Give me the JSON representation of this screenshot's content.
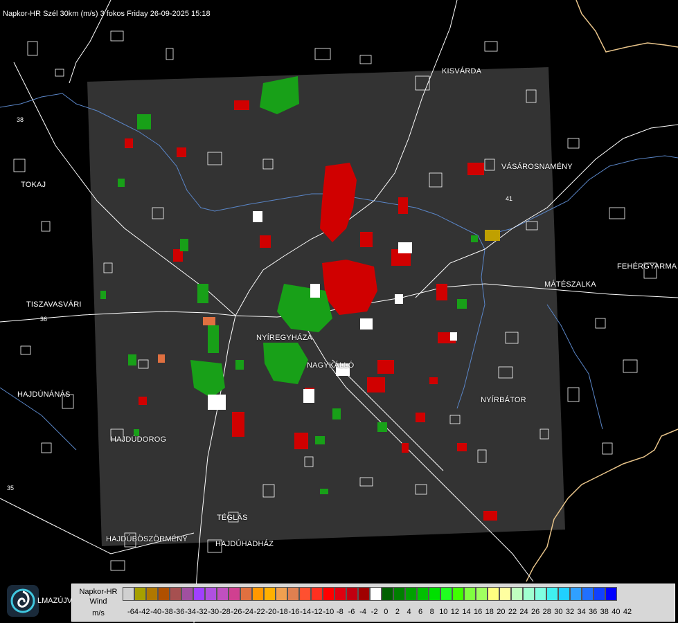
{
  "header": {
    "title": "Napkor-HR Szél 30km (m/s) 3 fokos Friday 26-09-2025 15:18"
  },
  "map": {
    "cities": [
      {
        "id": "kisvarda",
        "label": "KISVÁRDA"
      },
      {
        "id": "tokaj",
        "label": "TOKAJ"
      },
      {
        "id": "vasarosnameny",
        "label": "VÁSÁROSNAMÉNY"
      },
      {
        "id": "fehergyarmat",
        "label": "FEHÉRGYARMA"
      },
      {
        "id": "mateszalka",
        "label": "MÁTÉSZALKA"
      },
      {
        "id": "tiszavasvari",
        "label": "TISZAVASVÁRI"
      },
      {
        "id": "nyiregyhaza",
        "label": "NYÍREGYHÁZA"
      },
      {
        "id": "nagykallo",
        "label": "NAGYKÁLLÓ"
      },
      {
        "id": "hajdunanas",
        "label": "HAJDÚNÁNÁS"
      },
      {
        "id": "nyirbator",
        "label": "NYÍRBÁTOR"
      },
      {
        "id": "hajdudorog",
        "label": "HAJDÚDOROG"
      },
      {
        "id": "teglas",
        "label": "TÉGLÁS"
      },
      {
        "id": "hajduboszormeny",
        "label": "HAJDÚBÖSZÖRMÉNY"
      },
      {
        "id": "hajduhadhaz",
        "label": "HAJDÚHADHÁZ"
      }
    ],
    "road_numbers": [
      "38",
      "36",
      "41",
      "35"
    ],
    "colors": {
      "background": "#000000",
      "radar_area": "#333333",
      "roads": "#ffffff",
      "rivers": "#5a86c8",
      "border": "#e8c48a"
    }
  },
  "footer": {
    "logo_text": "LMAZÚJVÁR",
    "logo_icon": "swirl-logo-icon",
    "legend": {
      "title_line1": "Napkor-HR",
      "title_line2": "Wind",
      "units": "m/s",
      "swatches": [
        "#d0d0d0",
        "#a6a000",
        "#b07800",
        "#b05000",
        "#a65050",
        "#a050a0",
        "#a040ff",
        "#b050e0",
        "#c050c0",
        "#d04090",
        "#e07040",
        "#ff9800",
        "#ffb000",
        "#f0a050",
        "#e08050",
        "#ff5030",
        "#ff3020",
        "#ff0000",
        "#e00010",
        "#c00010",
        "#a00000",
        "#ffffff",
        "#006000",
        "#008000",
        "#00a000",
        "#00c000",
        "#00e000",
        "#20ff20",
        "#40ff00",
        "#80ff40",
        "#a0ff60",
        "#ffff80",
        "#ffffa0",
        "#c0ffc0",
        "#a0ffd0",
        "#80ffe0",
        "#40f0f0",
        "#20d0ff",
        "#30a0ff",
        "#2070ff",
        "#1040ff",
        "#0000ff"
      ],
      "ticks": [
        "-64",
        "-42",
        "-40",
        "-38",
        "-36",
        "-34",
        "-32",
        "-30",
        "-28",
        "-26",
        "-24",
        "-22",
        "-20",
        "-18",
        "-16",
        "-14",
        "-12",
        "-10",
        "-8",
        "-6",
        "-4",
        "-2",
        "0",
        "2",
        "4",
        "6",
        "8",
        "10",
        "12",
        "14",
        "16",
        "18",
        "20",
        "22",
        "24",
        "26",
        "28",
        "30",
        "32",
        "34",
        "36",
        "38",
        "40",
        "42"
      ]
    }
  }
}
